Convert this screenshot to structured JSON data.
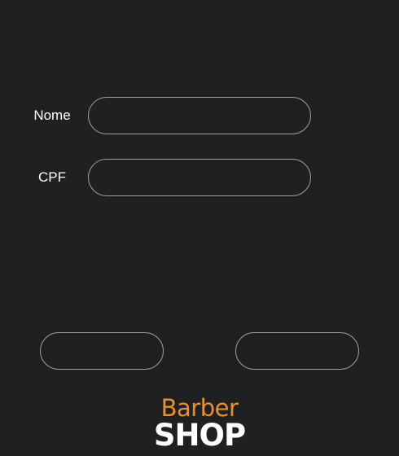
{
  "form": {
    "name_label": "Nome",
    "name_value": "",
    "cpf_label": "CPF",
    "cpf_value": ""
  },
  "buttons": {
    "left_label": "",
    "right_label": ""
  },
  "logo": {
    "line1": "Barber",
    "line2": "SHOP"
  },
  "colors": {
    "background": "#1f2022",
    "text": "#ffffff",
    "border": "#9a9a9a",
    "accent": "#e98f2c"
  }
}
